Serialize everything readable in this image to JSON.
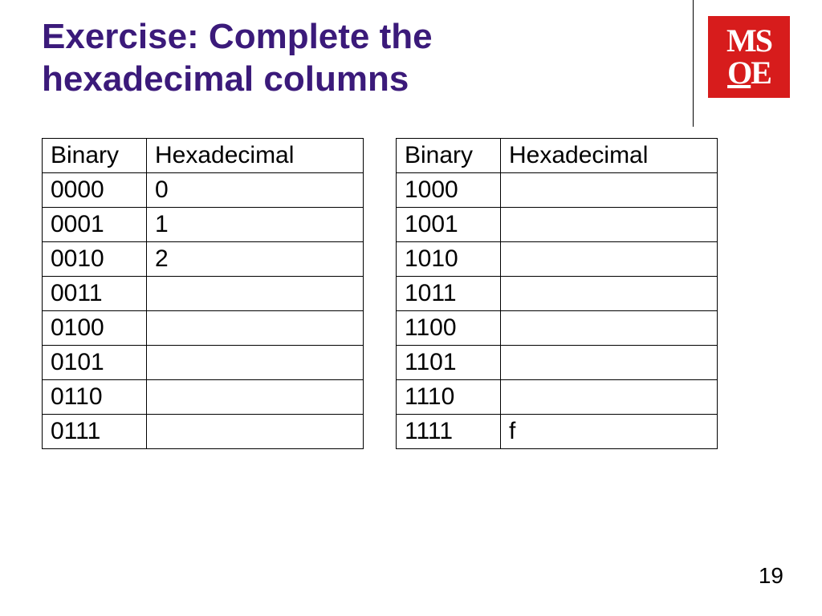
{
  "title_line1": "Exercise: Complete the",
  "title_line2": "hexadecimal columns",
  "logo": {
    "top": "MS",
    "bottom_left": "O",
    "bottom_right": "E"
  },
  "headers": {
    "binary": "Binary",
    "hex": "Hexadecimal"
  },
  "left_table": [
    {
      "bin": "0000",
      "hex": "0"
    },
    {
      "bin": "0001",
      "hex": "1"
    },
    {
      "bin": "0010",
      "hex": "2"
    },
    {
      "bin": "0011",
      "hex": ""
    },
    {
      "bin": "0100",
      "hex": ""
    },
    {
      "bin": "0101",
      "hex": ""
    },
    {
      "bin": "0110",
      "hex": ""
    },
    {
      "bin": "0111",
      "hex": ""
    }
  ],
  "right_table": [
    {
      "bin": "1000",
      "hex": ""
    },
    {
      "bin": "1001",
      "hex": ""
    },
    {
      "bin": "1010",
      "hex": ""
    },
    {
      "bin": "1011",
      "hex": ""
    },
    {
      "bin": "1100",
      "hex": ""
    },
    {
      "bin": "1101",
      "hex": ""
    },
    {
      "bin": "1110",
      "hex": ""
    },
    {
      "bin": "1111",
      "hex": "f"
    }
  ],
  "page_number": "19"
}
